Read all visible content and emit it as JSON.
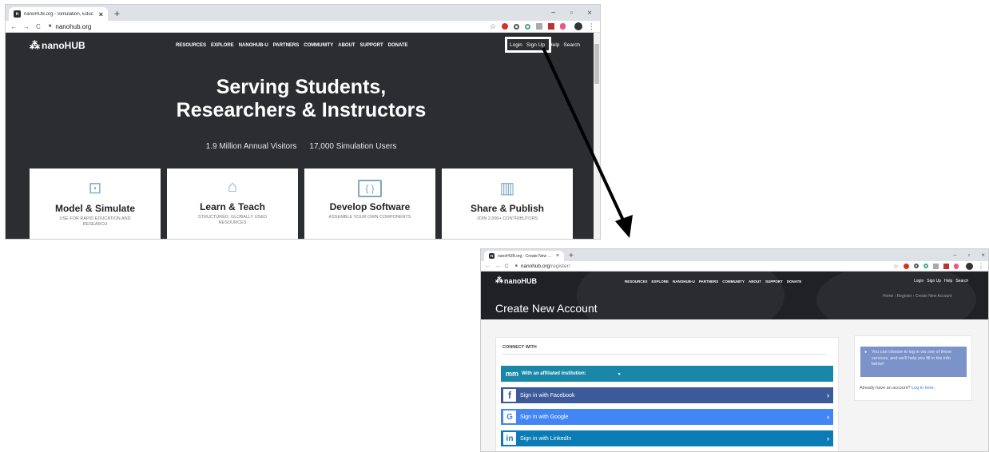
{
  "top_browser": {
    "tab_title": "nanoHUB.org - Simulation, Educ",
    "tab_favicon": "n",
    "close_glyph": "×",
    "new_tab_glyph": "+",
    "url": "nanohub.org",
    "win": [
      "−",
      "▫",
      "×"
    ]
  },
  "top_site": {
    "logo": "nanoHUB",
    "nav": [
      "RESOURCES",
      "EXPLORE",
      "NANOHUB-U",
      "PARTNERS",
      "COMMUNITY",
      "ABOUT",
      "SUPPORT",
      "DONATE"
    ],
    "user_nav": [
      "Login",
      "Sign Up",
      "Help",
      "Search"
    ],
    "hero_line1": "Serving Students,",
    "hero_line2": "Researchers & Instructors",
    "stat1": "1.9 Million Annual Visitors",
    "stat2": "17,000 Simulation Users",
    "cards": [
      {
        "title": "Model & Simulate",
        "desc": "USE FOR RAPID EDUCATION AND RESEARCH",
        "icon": "monitor-icon"
      },
      {
        "title": "Learn & Teach",
        "desc": "STRUCTURED, GLOBALLY USED RESOURCES",
        "icon": "graduation-cap-icon"
      },
      {
        "title": "Develop Software",
        "desc": "ASSEMBLE YOUR OWN COMPONENTS",
        "icon": "code-window-icon"
      },
      {
        "title": "Share & Publish",
        "desc": "JOIN 2,000+ CONTRIBUTORS",
        "icon": "book-icon"
      }
    ]
  },
  "bottom_browser": {
    "tab_title": "nanoHUB.org - Create New Acc",
    "tab_favicon": "n",
    "close_glyph": "×",
    "new_tab_glyph": "+",
    "url_host": "nanohub.org",
    "url_path": "/register/",
    "win": [
      "−",
      "▫",
      "×"
    ]
  },
  "bottom_site": {
    "logo": "nanoHUB",
    "nav": [
      "RESOURCES",
      "EXPLORE",
      "NANOHUB-U",
      "PARTNERS",
      "COMMUNITY",
      "ABOUT",
      "SUPPORT",
      "DONATE"
    ],
    "user_nav": [
      "Login",
      "Sign Up",
      "Help",
      "Search"
    ],
    "breadcrumb": "Home › Register › Create New Account",
    "page_title": "Create New Account",
    "connect_heading": "CONNECT WITH",
    "providers": [
      {
        "label": "With an affiliated institution:",
        "icon": "mm",
        "extra": "▾",
        "color": "#1a87a8"
      },
      {
        "label": "Sign in with Facebook",
        "icon": "f",
        "extra": "›",
        "color": "#3c5a99"
      },
      {
        "label": "Sign in with Google",
        "icon": "G",
        "extra": "›",
        "color": "#4285f4"
      },
      {
        "label": "Sign in with LinkedIn",
        "icon": "in",
        "extra": "›",
        "color": "#0a7bb5"
      }
    ],
    "info_text": "You can choose to log in via one of these services, and we'll help you fill in the info below!",
    "info_icon": "●",
    "already_text": "Already have an account?",
    "already_link": "Log in here."
  },
  "colors": {
    "highlight": "#ffffff",
    "arrow": "#000000",
    "site_dark": "#2b2d31"
  }
}
